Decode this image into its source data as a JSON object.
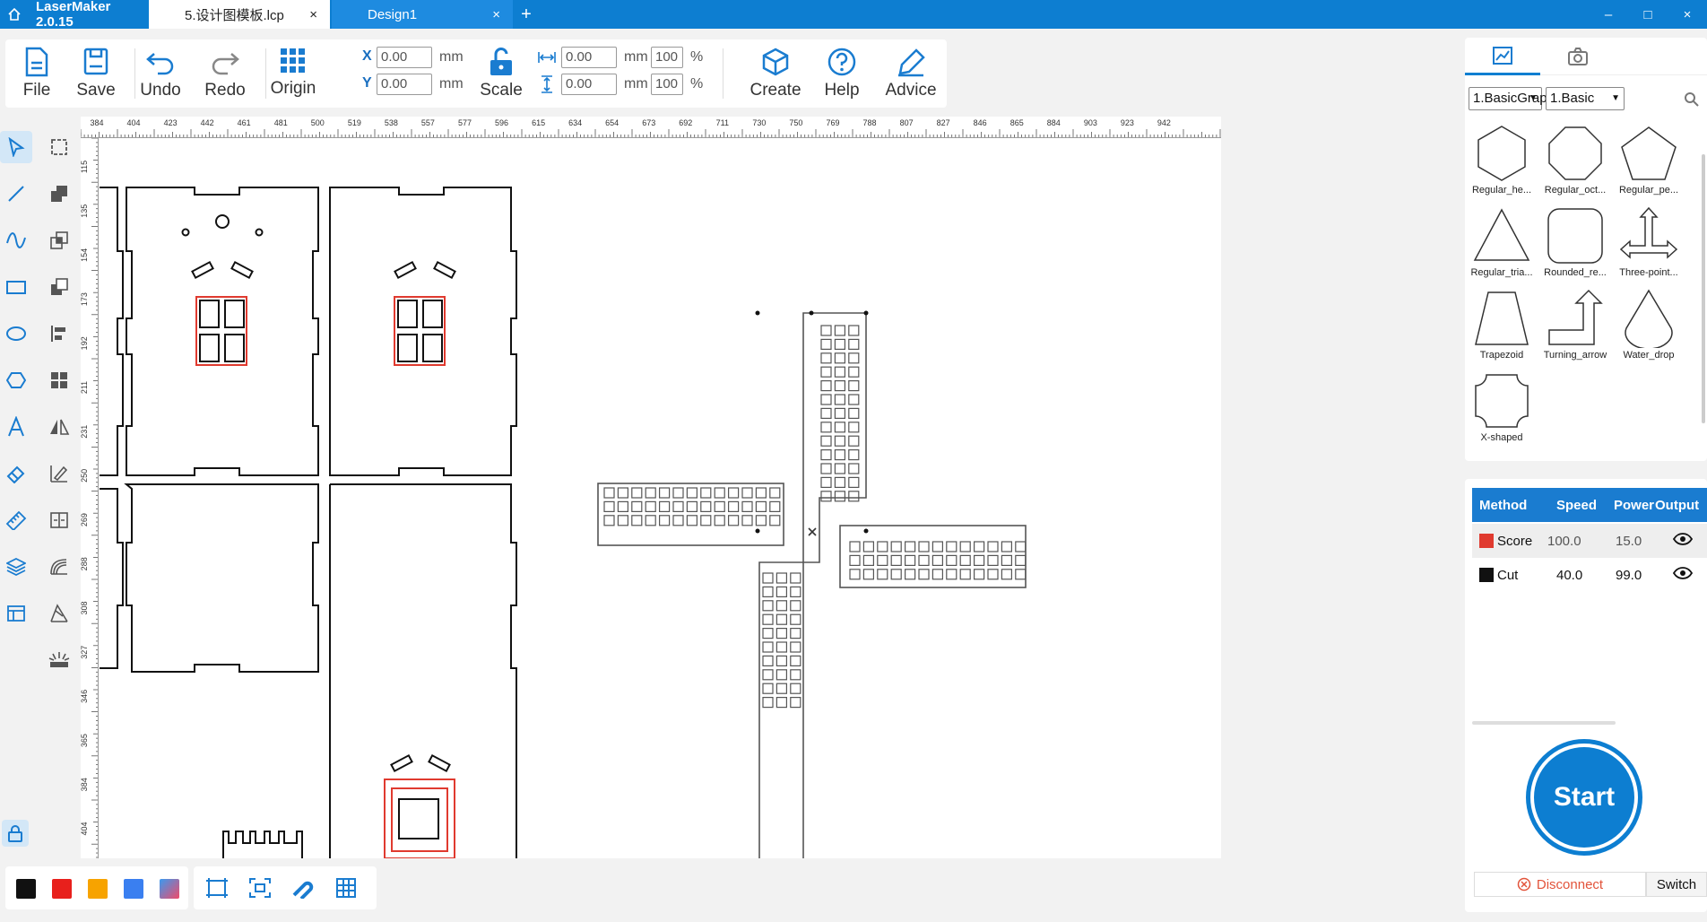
{
  "titlebar": {
    "app_name": "LaserMaker 2.0.15",
    "tabs": [
      {
        "label": "5.设计图模板.lcp",
        "active": true
      },
      {
        "label": "Design1",
        "active": false
      }
    ],
    "add_tab": "+",
    "close_glyph": "×",
    "controls": {
      "minimize": "–",
      "maximize": "□",
      "close": "×"
    }
  },
  "toolbar": {
    "file": "File",
    "save": "Save",
    "undo": "Undo",
    "redo": "Redo",
    "origin": "Origin",
    "x_label": "X",
    "y_label": "Y",
    "x_value": "0.00",
    "y_value": "0.00",
    "unit": "mm",
    "scale": "Scale",
    "width_value": "0.00",
    "height_value": "0.00",
    "width_pct": "100",
    "height_pct": "100",
    "pct": "%",
    "create": "Create",
    "help": "Help",
    "advice": "Advice"
  },
  "ruler": {
    "unit": "mm",
    "top_ticks": [
      "384",
      "404",
      "423",
      "442",
      "461",
      "481",
      "500",
      "519",
      "538",
      "557",
      "577",
      "596",
      "615",
      "634",
      "654",
      "673",
      "692",
      "711",
      "730",
      "750",
      "769",
      "788",
      "807",
      "827",
      "846",
      "865",
      "884",
      "903",
      "923",
      "942"
    ],
    "left_ticks": [
      "115",
      "135",
      "154",
      "173",
      "192",
      "211",
      "231",
      "250",
      "269",
      "288",
      "308",
      "327",
      "346",
      "365",
      "384",
      "404"
    ]
  },
  "shapes_panel": {
    "category_select": "1.BasicGrap",
    "sub_select": "1.Basic",
    "items": [
      {
        "name": "Regular_he..."
      },
      {
        "name": "Regular_oct..."
      },
      {
        "name": "Regular_pe..."
      },
      {
        "name": "Regular_tria..."
      },
      {
        "name": "Rounded_re..."
      },
      {
        "name": "Three-point..."
      },
      {
        "name": "Trapezoid"
      },
      {
        "name": "Turning_arrow"
      },
      {
        "name": "Water_drop"
      },
      {
        "name": "X-shaped"
      }
    ]
  },
  "layers": {
    "headers": {
      "method": "Method",
      "speed": "Speed",
      "power": "Power",
      "output": "Output"
    },
    "rows": [
      {
        "method": "Score",
        "speed": "100.0",
        "power": "15.0",
        "color": "#e03a2f"
      },
      {
        "method": "Cut",
        "speed": "40.0",
        "power": "99.0",
        "color": "#111111"
      }
    ]
  },
  "device": {
    "start": "Start",
    "disconnect": "Disconnect",
    "switch": "Switch"
  },
  "palette": {
    "colors": [
      "#111111",
      "#e8201c",
      "#f7a300",
      "#3a7ff0"
    ]
  },
  "theme": {
    "accent": "#0d7ed1",
    "score_color": "#e03a2f",
    "cut_color": "#111111"
  }
}
